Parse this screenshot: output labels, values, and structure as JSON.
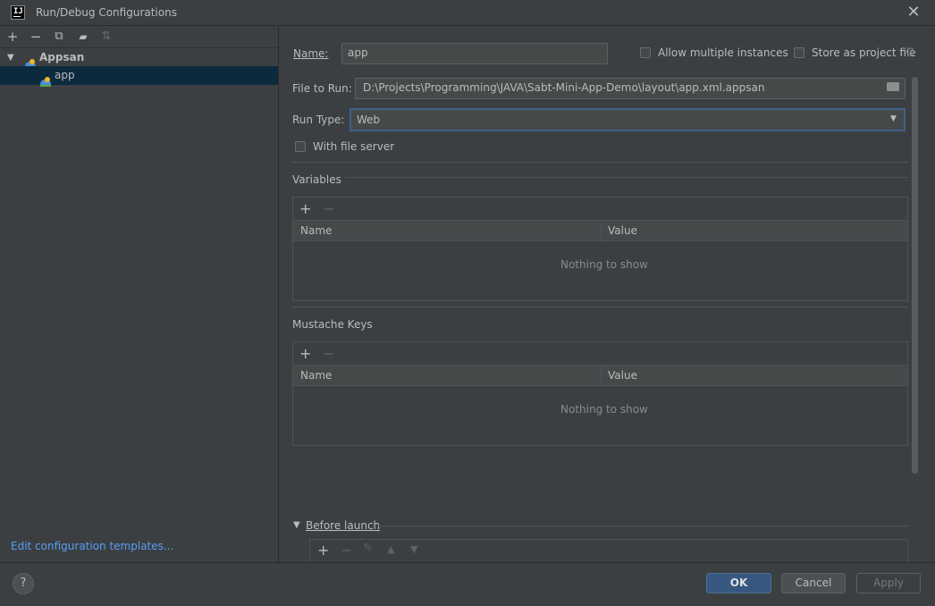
{
  "window": {
    "title": "Run/Debug Configurations",
    "app_icon_text": "IJ"
  },
  "toolbar": {
    "add": "+",
    "remove": "−",
    "copy": "⧉",
    "folder": "▰",
    "sort": "⇅"
  },
  "tree": [
    {
      "label": "Appsan",
      "expanded": true
    },
    {
      "label": "app",
      "selected": true
    }
  ],
  "left_footer": {
    "link": "Edit configuration templates..."
  },
  "form": {
    "name_label": "Name:",
    "name_value": "app",
    "allow_multiple": "Allow multiple instances",
    "store_project": "Store as project file",
    "file_label": "File to Run:",
    "file_value": "D:\\Projects\\Programming\\JAVA\\Sabt-Mini-App-Demo\\layout\\app.xml.appsan",
    "run_type_label": "Run Type:",
    "run_type_value": "Web",
    "with_file_server": "With file server"
  },
  "variables": {
    "title": "Variables",
    "col_name": "Name",
    "col_value": "Value",
    "empty": "Nothing to show"
  },
  "mustache": {
    "title": "Mustache Keys",
    "col_name": "Name",
    "col_value": "Value",
    "empty": "Nothing to show"
  },
  "before_launch": {
    "title": "Before launch"
  },
  "buttons": {
    "ok": "OK",
    "cancel": "Cancel",
    "apply": "Apply",
    "help": "?"
  },
  "colors": {
    "background": "#3c3f41",
    "selection": "#0d293e",
    "link": "#589df6",
    "ok_button": "#365880",
    "focus_border": "#3d6185"
  }
}
